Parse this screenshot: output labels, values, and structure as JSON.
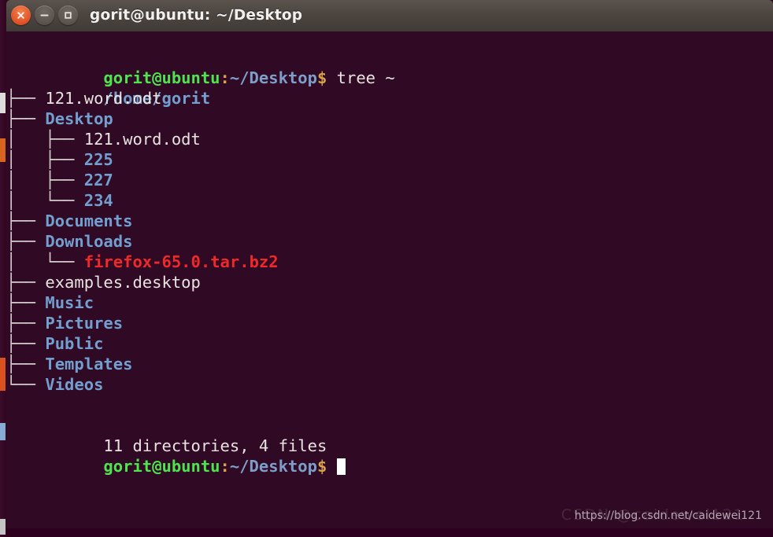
{
  "window": {
    "title": "gorit@ubuntu: ~/Desktop",
    "controls": {
      "close_label": "close-window",
      "minimize_label": "minimize-window",
      "maximize_label": "maximize-window"
    }
  },
  "terminal": {
    "prompt": {
      "user_host": "gorit@ubuntu",
      "separator": ":",
      "path": "~/Desktop",
      "sigil": "$"
    },
    "command": " tree ~",
    "root": "/home/gorit",
    "tree_lines": [
      {
        "branch": "├── ",
        "name": "121.word.odt",
        "type": "file"
      },
      {
        "branch": "├── ",
        "name": "Desktop",
        "type": "dir"
      },
      {
        "branch": "│   ├── ",
        "name": "121.word.odt",
        "type": "file"
      },
      {
        "branch": "│   ├── ",
        "name": "225",
        "type": "dir"
      },
      {
        "branch": "│   ├── ",
        "name": "227",
        "type": "dir"
      },
      {
        "branch": "│   └── ",
        "name": "234",
        "type": "dir"
      },
      {
        "branch": "├── ",
        "name": "Documents",
        "type": "dir"
      },
      {
        "branch": "├── ",
        "name": "Downloads",
        "type": "dir"
      },
      {
        "branch": "│   └── ",
        "name": "firefox-65.0.tar.bz2",
        "type": "archive"
      },
      {
        "branch": "├── ",
        "name": "examples.desktop",
        "type": "file"
      },
      {
        "branch": "├── ",
        "name": "Music",
        "type": "dir"
      },
      {
        "branch": "├── ",
        "name": "Pictures",
        "type": "dir"
      },
      {
        "branch": "├── ",
        "name": "Public",
        "type": "dir"
      },
      {
        "branch": "├── ",
        "name": "Templates",
        "type": "dir"
      },
      {
        "branch": "└── ",
        "name": "Videos",
        "type": "dir"
      }
    ],
    "summary": "11 directories, 4 files",
    "colors": {
      "background": "#300a24",
      "directory": "#729fcf",
      "file": "#e7e3e0",
      "archive": "#ef2929",
      "prompt_user": "#4ee44e",
      "prompt_path": "#7d9ec9"
    }
  },
  "watermark": {
    "url": "https://blog.csdn.net/caidewei121",
    "ghost": "CSDN @caidewei121"
  }
}
